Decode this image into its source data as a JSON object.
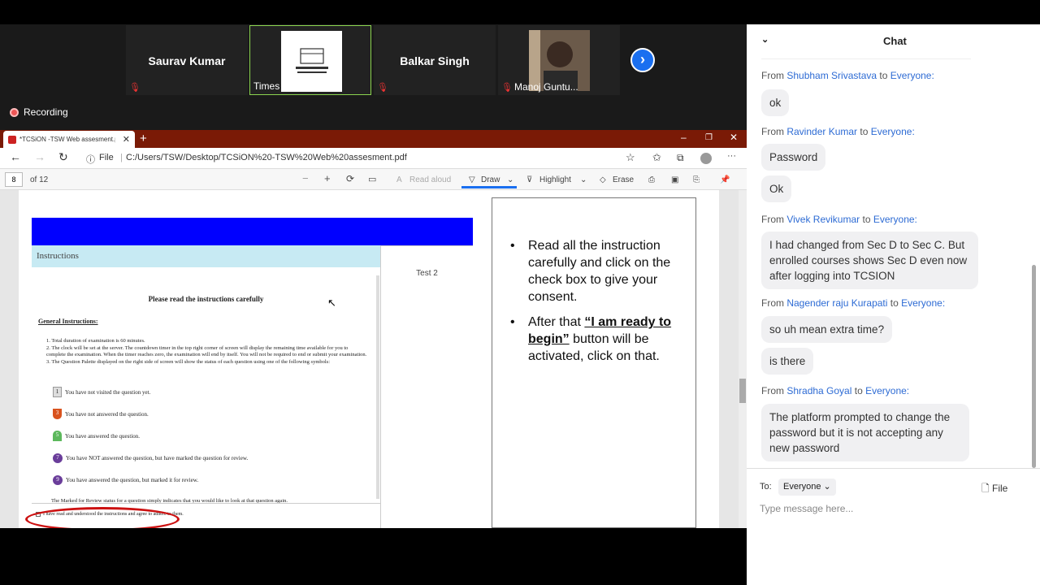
{
  "participants": [
    {
      "name": "Saurav Kumar"
    },
    {
      "label": "Times Professio..."
    },
    {
      "name": "Balkar Singh"
    },
    {
      "label": "Manoj Guntu..."
    }
  ],
  "recording": "Recording",
  "browser": {
    "tab_title": "*TCSiON -TSW Web assesment.p",
    "file_label": "File",
    "url": "C:/Users/TSW/Desktop/TCSiON%20-TSW%20Web%20assesment.pdf",
    "page_num": "8",
    "page_total": "of 12",
    "read_aloud": "Read aloud",
    "draw": "Draw",
    "highlight": "Highlight",
    "erase": "Erase"
  },
  "pdf": {
    "instructions_header": "Instructions",
    "test_label": "Test 2",
    "heading": "Please read the instructions carefully",
    "general": "General Instructions:",
    "items": [
      "1. Total duration of examination is 60 minutes.",
      "2. The clock will be set at the server. The countdown timer in the top right corner of screen will display the remaining time available for you to complete the examination. When the timer reaches zero, the examination will end by itself. You will not be required to end or submit your examination.",
      "3. The Question Palette displayed on the right side of screen will show the status of each question using one of the following symbols:"
    ],
    "symbols": [
      {
        "num": "1",
        "text": "You have not visited the question yet.",
        "color": "#dddddd"
      },
      {
        "num": "3",
        "text": "You have not answered the question.",
        "color": "#d9531e"
      },
      {
        "num": "5",
        "text": "You have answered the question.",
        "color": "#5cb85c"
      },
      {
        "num": "7",
        "text": "You have NOT answered the question, but have marked the question for review.",
        "color": "#6a3d9a"
      },
      {
        "num": "9",
        "text": "You have answered the question, but marked it for review.",
        "color": "#6a3d9a"
      }
    ],
    "cut_line": "The Marked for Review status for a question simply indicates that you would like to look at that question again.",
    "consent": "I have read and understood the instructions and agree to adhere to them."
  },
  "slide": {
    "bullet1": "Read all the instruction carefully and click on the check box to give your consent.",
    "bullet2_pre": "After that ",
    "bullet2_em": "“I am ready to begin”",
    "bullet2_post": " button will be activated, click on that."
  },
  "chat": {
    "title": "Chat",
    "messages": [
      {
        "from": "Shubham Srivastava",
        "to": "Everyone:",
        "text": "ok"
      },
      {
        "from": "Ravinder Kumar",
        "to": "Everyone:",
        "text": "Password"
      },
      {
        "text": "Ok"
      },
      {
        "from": "Vivek Revikumar",
        "to": "Everyone:",
        "text": "I had changed from Sec D to Sec C.  But enrolled courses shows Sec D even now after logging into TCSION"
      },
      {
        "from": "Nagender raju Kurapati",
        "to": "Everyone:",
        "text": "so uh mean extra time?"
      },
      {
        "text": "is there"
      },
      {
        "from": "Shradha Goyal",
        "to": "Everyone:",
        "text": "The platform prompted to change the password but it is not accepting any new password"
      }
    ],
    "from_word": "From",
    "to_word": "to",
    "to_label": "To:",
    "to_value": "Everyone",
    "file_label": "File",
    "placeholder": "Type message here..."
  }
}
